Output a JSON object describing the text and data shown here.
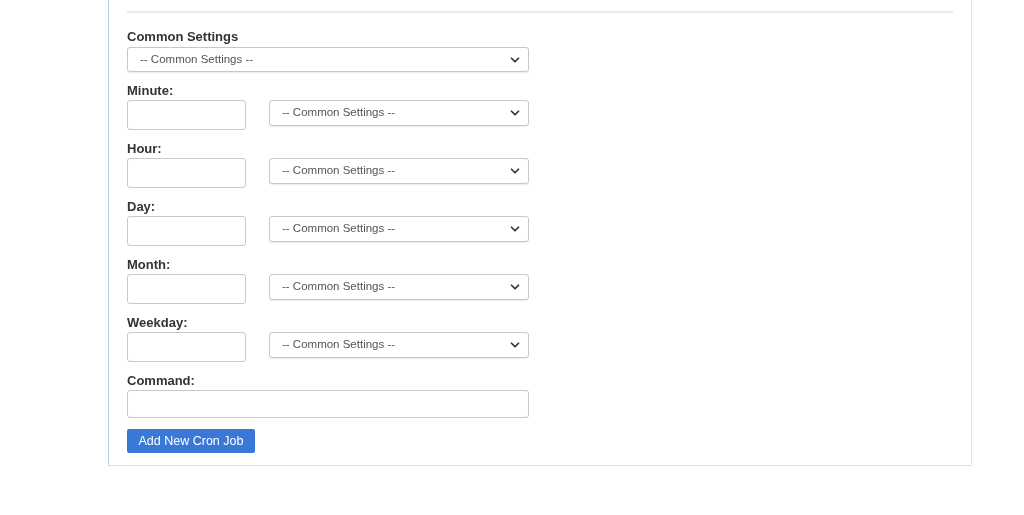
{
  "common_settings": {
    "label": "Common Settings",
    "value": "-- Common Settings --"
  },
  "fields": [
    {
      "label": "Minute:",
      "select_value": "-- Common Settings --"
    },
    {
      "label": "Hour:",
      "select_value": "-- Common Settings --"
    },
    {
      "label": "Day:",
      "select_value": "-- Common Settings --"
    },
    {
      "label": "Month:",
      "select_value": "-- Common Settings --"
    },
    {
      "label": "Weekday:",
      "select_value": "-- Common Settings --"
    }
  ],
  "command": {
    "label": "Command:"
  },
  "submit_button": "Add New Cron Job"
}
